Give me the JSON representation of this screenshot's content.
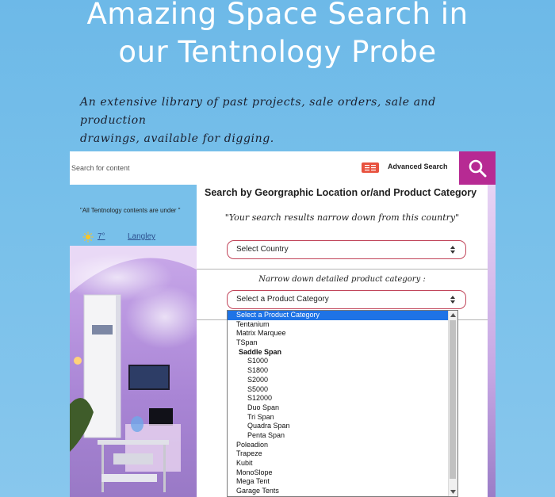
{
  "hero": {
    "title_line1": "Amazing Space Search in",
    "title_line2": "our Tentnology Probe",
    "tagline_line1": "An extensive library of past projects, sale orders, sale and production",
    "tagline_line2": "drawings, available for digging."
  },
  "search": {
    "placeholder": "Search for content",
    "advanced_label": "Advanced Search",
    "advanced_icon": "document-icon",
    "submit_icon": "magnifier-icon",
    "accent_color": "#b72a93"
  },
  "sidebar": {
    "note": "\"All Tentnology contents are under \"",
    "weather_icon": "sun-icon",
    "temperature": "7°",
    "city": "Langley"
  },
  "panel": {
    "title": "Search by Georgraphic Location or/and Product Category",
    "subtitle1": "\"Your search results narrow down from this country\"",
    "country_select": "Select Country",
    "subtitle2": "Narrow down detailed product category :",
    "category_select": "Select a Product Category"
  },
  "dropdown": {
    "options": [
      {
        "label": "Select a Product Category",
        "kind": "selected"
      },
      {
        "label": "Tentanium",
        "kind": "item"
      },
      {
        "label": "Matrix Marquee",
        "kind": "item"
      },
      {
        "label": "TSpan",
        "kind": "item"
      },
      {
        "label": "Saddle Span",
        "kind": "group"
      },
      {
        "label": "S1000",
        "kind": "sub"
      },
      {
        "label": "S1800",
        "kind": "sub"
      },
      {
        "label": "S2000",
        "kind": "sub"
      },
      {
        "label": "S5000",
        "kind": "sub"
      },
      {
        "label": "S12000",
        "kind": "sub"
      },
      {
        "label": "Duo Span",
        "kind": "sub"
      },
      {
        "label": "Tri Span",
        "kind": "sub"
      },
      {
        "label": "Quadra Span",
        "kind": "sub"
      },
      {
        "label": "Penta Span",
        "kind": "sub"
      },
      {
        "label": "Poleadion",
        "kind": "item"
      },
      {
        "label": "Trapeze",
        "kind": "item"
      },
      {
        "label": "Kubit",
        "kind": "item"
      },
      {
        "label": "MonoSlope",
        "kind": "item"
      },
      {
        "label": "Mega Tent",
        "kind": "item"
      },
      {
        "label": "Garage Tents",
        "kind": "item"
      }
    ]
  }
}
